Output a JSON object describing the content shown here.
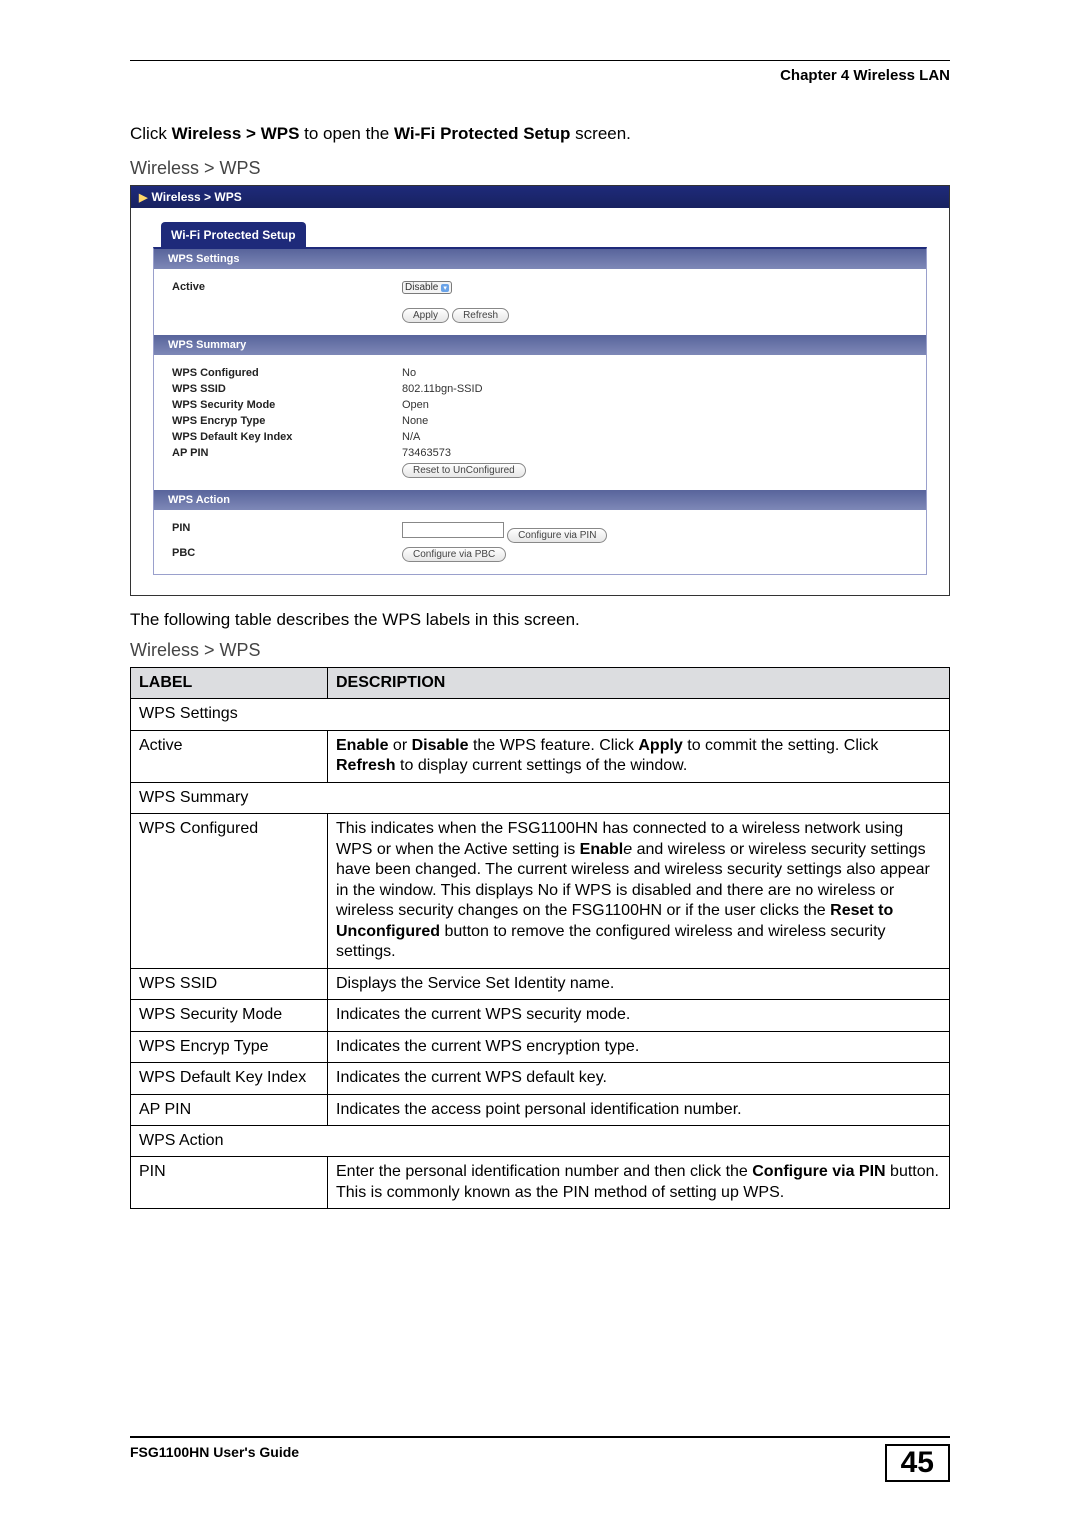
{
  "header": {
    "chapter": "Chapter 4 Wireless LAN"
  },
  "intro": {
    "pre": "Click ",
    "bold1": "Wireless > WPS",
    "mid": " to open the ",
    "bold2": "Wi-Fi Protected Setup",
    "post": " screen."
  },
  "fig_caption_1": "Wireless > WPS",
  "screenshot": {
    "titlebar": "Wireless > WPS",
    "tab": "Wi-Fi Protected Setup",
    "settings": {
      "heading": "WPS Settings",
      "active_label": "Active",
      "active_value": "Disable",
      "apply_btn": "Apply",
      "refresh_btn": "Refresh"
    },
    "summary": {
      "heading": "WPS Summary",
      "rows": {
        "configured_label": "WPS Configured",
        "configured_value": "No",
        "ssid_label": "WPS SSID",
        "ssid_value": "802.11bgn-SSID",
        "secmode_label": "WPS Security Mode",
        "secmode_value": "Open",
        "encryp_label": "WPS Encryp Type",
        "encryp_value": "None",
        "defkey_label": "WPS Default Key Index",
        "defkey_value": "N/A",
        "appin_label": "AP PIN",
        "appin_value": "73463573"
      },
      "reset_btn": "Reset to UnConfigured"
    },
    "action": {
      "heading": "WPS Action",
      "pin_label": "PIN",
      "pin_btn": "Configure via PIN",
      "pbc_label": "PBC",
      "pbc_btn": "Configure via PBC"
    }
  },
  "followup": "The following table describes the WPS labels in this screen.",
  "fig_caption_2": "Wireless > WPS",
  "table": {
    "head_label": "LABEL",
    "head_desc": "DESCRIPTION",
    "r1_label": "WPS Settings",
    "r2_label": "Active",
    "r2_desc_parts": {
      "b1": "Enable",
      "t1": " or ",
      "b2": "Disable",
      "t2": " the WPS feature. Click ",
      "b3": "Apply",
      "t3": " to commit the setting. Click ",
      "b4": "Refresh",
      "t4": " to display current settings of the window."
    },
    "r3_label": "WPS Summary",
    "r4_label": "WPS Configured",
    "r4_desc_parts": {
      "t1": "This indicates when the FSG1100HN has connected to a wireless network using WPS or when the Active setting is ",
      "b1": "Enabl",
      "i1": "e",
      "t2": " and wireless or wireless security settings have been changed. The current wireless and wireless security settings also appear in the window. This displays No if WPS is disabled and there are no wireless or wireless security changes on the FSG1100HN or if the user clicks the ",
      "b2": "Reset to Unconfigured",
      "t3": " button to remove the configured wireless and wireless security settings."
    },
    "r5_label": "WPS SSID",
    "r5_desc": "Displays the Service Set Identity name.",
    "r6_label": "WPS Security Mode",
    "r6_desc": "Indicates the current WPS security mode.",
    "r7_label": "WPS Encryp Type",
    "r7_desc": "Indicates the current WPS encryption type.",
    "r8_label": "WPS Default Key Index",
    "r8_desc": "Indicates the current WPS default key.",
    "r9_label": "AP PIN",
    "r9_desc": "Indicates the access point personal identification number.",
    "r10_label": "WPS Action",
    "r11_label": "PIN",
    "r11_desc_parts": {
      "t1": "Enter the personal identification number and then click the ",
      "b1": "Configure via PIN",
      "t2": " button. This is commonly known as the PIN method of setting up WPS."
    }
  },
  "footer": {
    "guide": "FSG1100HN User's Guide",
    "page": "45"
  }
}
